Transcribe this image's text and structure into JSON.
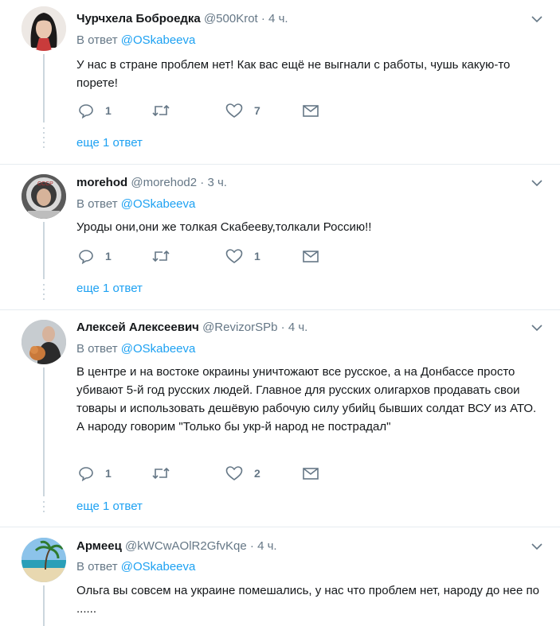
{
  "reply_prefix": "В ответ",
  "more_label": "еще 1 ответ",
  "tweets": [
    {
      "name": "Чурчхела Боброедка",
      "handle": "@500Krot",
      "time": "· 4 ч.",
      "reply_to": "@OSkabeeva",
      "text": "У нас в стране проблем нет! Как вас ещё не выгнали с работы, чушь какую-то порете!",
      "replies": "1",
      "retweets": "",
      "likes": "7",
      "avatar": "woman-avatar"
    },
    {
      "name": "morehod",
      "handle": "@morehod2",
      "time": "· 3 ч.",
      "reply_to": "@OSkabeeva",
      "text": "Уроды они,они же толкая Скабееву,толкали Россию!!",
      "replies": "1",
      "retweets": "",
      "likes": "1",
      "avatar": "cosmonaut-avatar"
    },
    {
      "name": "Алексей Алексеевич",
      "handle": "@RevizorSPb",
      "time": "· 4 ч.",
      "reply_to": "@OSkabeeva",
      "text": "В центре и на востоке окраины уничтожают все русское, а на Донбассе просто убивают 5-й год русских людей. Главное для русских олигархов продавать свои товары и использовать дешёвую рабочую силу убийц бывших солдат ВСУ из АТО. А народу говорим \"Только бы укр-й народ не пострадал\"",
      "replies": "1",
      "retweets": "",
      "likes": "2",
      "avatar": "man-with-dog-avatar"
    },
    {
      "name": "Армеец",
      "handle": "@kWCwAOlR2GfvKqe",
      "time": "· 4 ч.",
      "reply_to": "@OSkabeeva",
      "text": "Ольга вы совсем на украине помешались, у нас что проблем нет, народу до нее по ......",
      "avatar": "beach-avatar"
    }
  ],
  "colors": {
    "link": "#1da1f2",
    "meta": "#657786",
    "separator": "#e6ecf0",
    "thread": "#ccd6dd"
  }
}
